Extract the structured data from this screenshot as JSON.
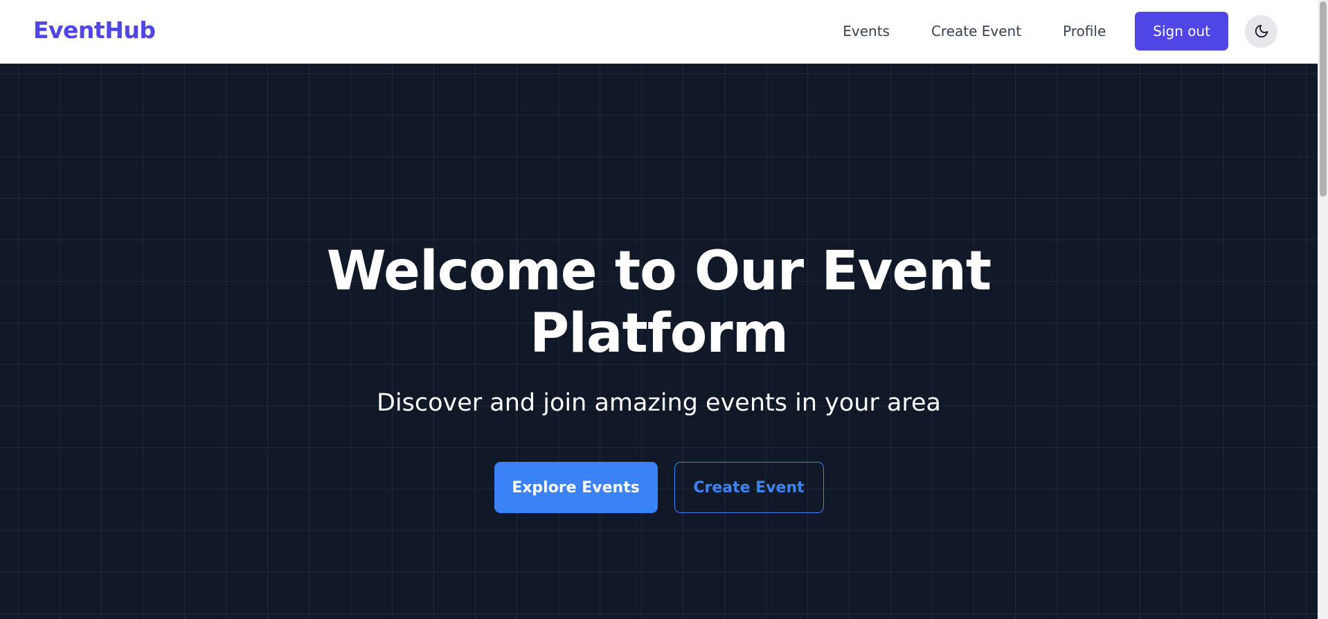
{
  "header": {
    "brand": "EventHub",
    "nav": [
      {
        "label": "Events"
      },
      {
        "label": "Create Event"
      },
      {
        "label": "Profile"
      }
    ],
    "sign_out_label": "Sign out",
    "theme_toggle_icon": "moon-icon"
  },
  "hero": {
    "title_line1": "Welcome to Our Event",
    "title_line2": "Platform",
    "subtitle": "Discover and join amazing events in your area",
    "primary_cta": "Explore Events",
    "secondary_cta": "Create Event"
  },
  "colors": {
    "brand": "#4f46e5",
    "hero_background": "#111827",
    "primary_button": "#3b82f6",
    "toggle_background": "#e5e7eb"
  }
}
